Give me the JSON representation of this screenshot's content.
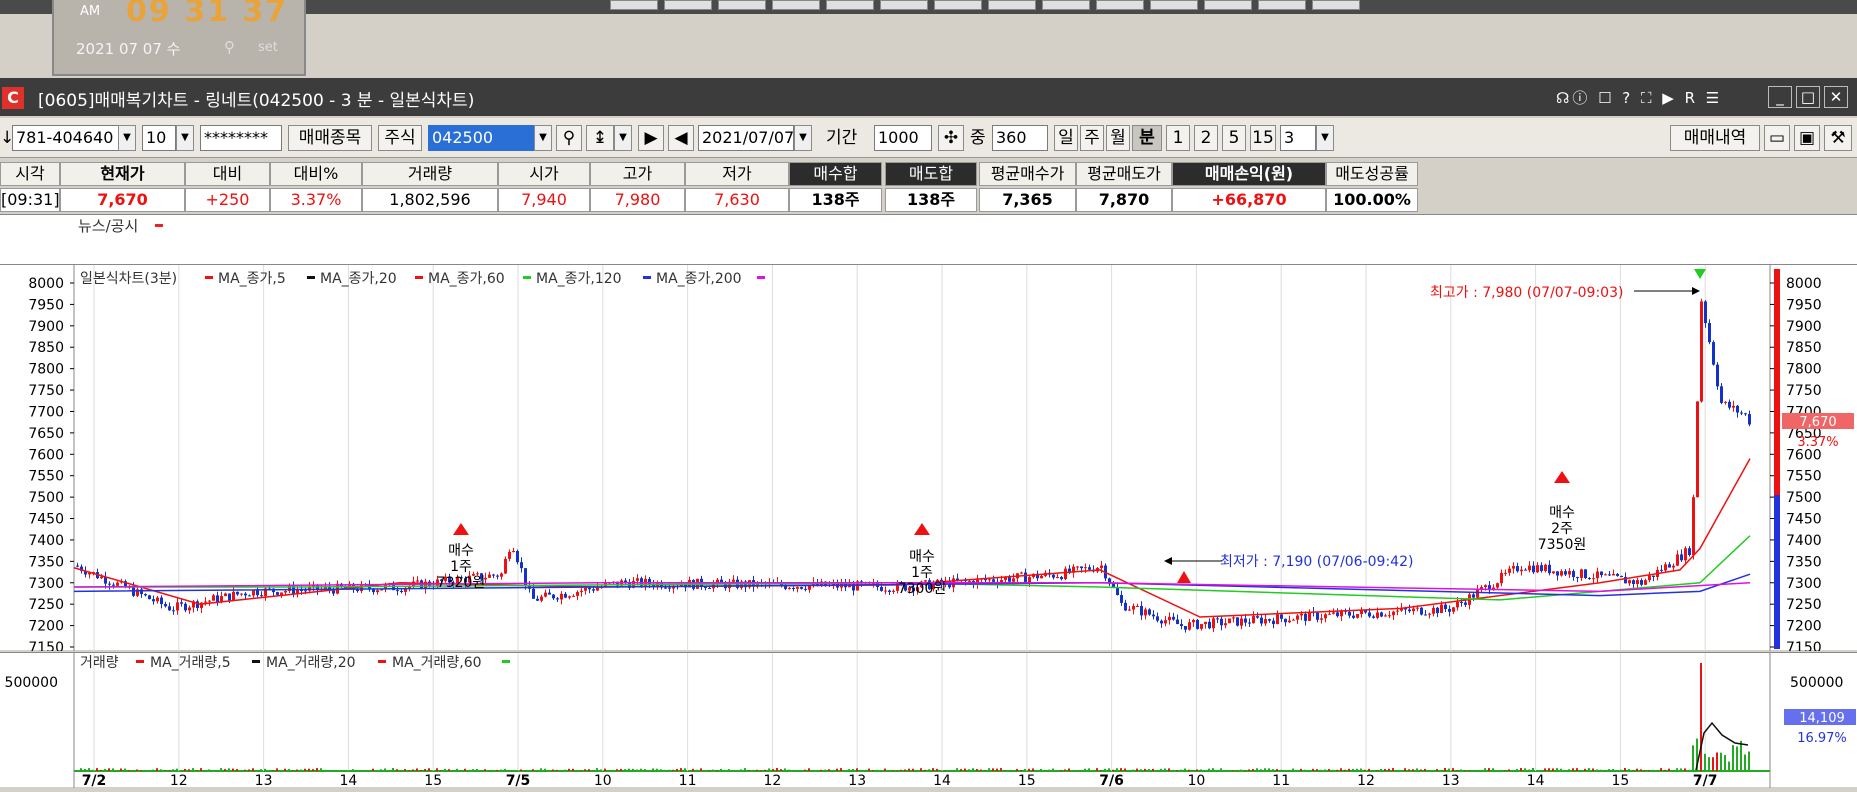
{
  "clock": {
    "ampm": "AM",
    "time": "09 31 37",
    "date": "2021 07 07 수",
    "set": "set"
  },
  "window": {
    "title": "[0605]매매복기차트 - 링네트(042500 - 3 분 - 일본식차트)",
    "icon": "C"
  },
  "toolbar": {
    "account": "781-404640",
    "account_sub": "10",
    "password": "********",
    "trade_items_btn": "매매종목",
    "stock_type": "주식",
    "code": "042500",
    "date": "2021/07/07",
    "period_label": "기간",
    "period": "1000",
    "mid_label": "중",
    "mid_value": "360",
    "tf_day": "일",
    "tf_week": "주",
    "tf_month": "월",
    "tf_min": "분",
    "tf_1": "1",
    "tf_2": "2",
    "tf_5": "5",
    "tf_15": "15",
    "tf_sel": "3",
    "history_btn": "매매내역"
  },
  "summary": {
    "headers": [
      "시각",
      "현재가",
      "대비",
      "대비%",
      "거래량",
      "시가",
      "고가",
      "저가",
      "매수합",
      "매도합",
      "평균매수가",
      "평균매도가",
      "매매손익(원)",
      "매도성공률"
    ],
    "values": [
      "[09:31]",
      "7,670",
      "+250",
      "3.37%",
      "1,802,596",
      "7,940",
      "7,980",
      "7,630",
      "138주",
      "138주",
      "7,365",
      "7,870",
      "+66,870",
      "100.00%"
    ]
  },
  "news": {
    "label": "뉴스/공시"
  },
  "legend": {
    "chart": "일본식차트(3분)",
    "ma5": "MA_종가,5",
    "ma20": "MA_종가,20",
    "ma60": "MA_종가,60",
    "ma120": "MA_종가,120",
    "ma200": "MA_종가,200",
    "vol": "거래량",
    "vma5": "MA_거래량,5",
    "vma20": "MA_거래량,20",
    "vma60": "MA_거래량,60"
  },
  "annotations": {
    "high": "최고가 : 7,980 (07/07-09:03)",
    "low": "최저가 : 7,190 (07/06-09:42)",
    "buy1_a": "매수",
    "buy1_b": "1주",
    "buy1_c": "7320원",
    "buy2_a": "매수",
    "buy2_b": "1주",
    "buy2_c": "7300원",
    "buy3_a": "매수",
    "buy3_b": "2주",
    "buy3_c": "7350원"
  },
  "price_tag": {
    "value": "7,670",
    "pct": "3.37%"
  },
  "vol_tag": {
    "value": "14,109",
    "pct": "16.97%"
  },
  "vol_axis": {
    "tick": "500000"
  },
  "y_axis": [
    "8000",
    "7950",
    "7900",
    "7850",
    "7800",
    "7750",
    "7700",
    "7650",
    "7600",
    "7550",
    "7500",
    "7450",
    "7400",
    "7350",
    "7300",
    "7250",
    "7200",
    "7150"
  ],
  "x_axis": [
    "7/2",
    "12",
    "13",
    "14",
    "15",
    "7/5",
    "10",
    "11",
    "12",
    "13",
    "14",
    "15",
    "7/6",
    "10",
    "11",
    "12",
    "13",
    "14",
    "15",
    "7/7"
  ],
  "colors": {
    "up": "#e11",
    "down": "#1133cc",
    "ma5": "#e11",
    "ma20": "#111",
    "ma60": "#e11",
    "ma120": "#22cc22",
    "ma200": "#2233dd"
  },
  "chart_data": {
    "type": "candlestick",
    "title": "일본식차트(3분)",
    "ylim": [
      7150,
      8000
    ],
    "x_sessions": [
      "7/2",
      "7/5",
      "7/6",
      "7/7"
    ],
    "high": 7980,
    "low": 7190,
    "current": 7670,
    "change_pct": 3.37,
    "trades": [
      {
        "type": "매수",
        "qty": "1주",
        "price": 7320
      },
      {
        "type": "매수",
        "qty": "1주",
        "price": 7300
      },
      {
        "type": "매수",
        "qty": "2주",
        "price": 7350
      }
    ],
    "volume": {
      "last": 14109,
      "pct": 16.97,
      "tick": 500000
    }
  }
}
